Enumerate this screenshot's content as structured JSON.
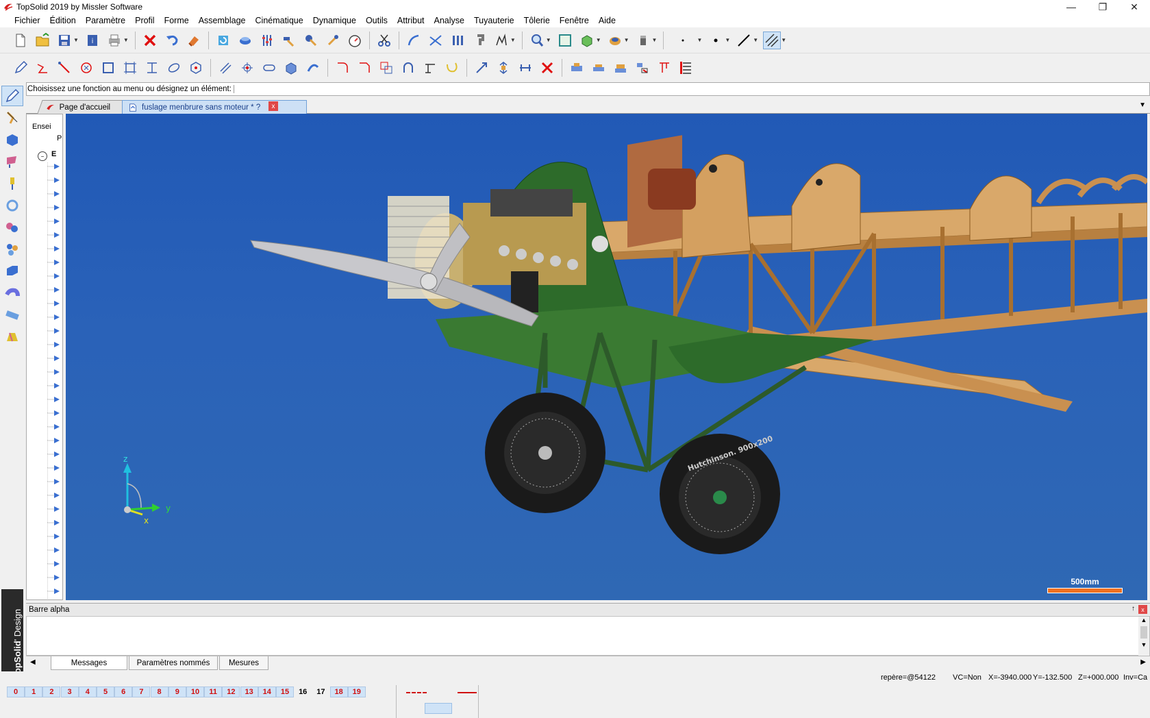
{
  "window": {
    "title": "TopSolid 2019 by Missler Software",
    "minimize": "—",
    "restore": "❐",
    "close": "✕"
  },
  "menu": [
    "Fichier",
    "Édition",
    "Paramètre",
    "Profil",
    "Forme",
    "Assemblage",
    "Cinématique",
    "Dynamique",
    "Outils",
    "Attribut",
    "Analyse",
    "Tuyauterie",
    "Tôlerie",
    "Fenêtre",
    "Aide"
  ],
  "prompt": {
    "text": "Choisissez une fonction au menu ou désignez un élément:"
  },
  "tabs": {
    "home": "Page d'accueil",
    "document": "fuslage menbrure sans moteur * ?",
    "close": "x",
    "dropdown": "▼"
  },
  "tree": {
    "header": "Ensei",
    "sub": "P",
    "root": "E",
    "scroll_left": "<"
  },
  "viewport": {
    "axis_z": "z",
    "axis_y": "y",
    "axis_x": "x",
    "scale_label": "500mm",
    "tire_text": "Hutchinson.  900x200"
  },
  "alpha": {
    "title": "Barre alpha",
    "pin": "↑",
    "close": "x",
    "scroll_up": "▲",
    "scroll_down": "▼"
  },
  "bottom_tabs": {
    "left_arrow": "◀",
    "right_arrow": "▶",
    "items": [
      "Messages",
      "Paramètres nommés",
      "Mesures"
    ]
  },
  "status": {
    "repere": "repère=@54122",
    "vc": "VC=Non",
    "x": "X=-3940.000",
    "y": "Y=-132.500",
    "z": "Z=+000.000",
    "inv": "Inv=Ca"
  },
  "layers": [
    "0",
    "1",
    "2",
    "3",
    "4",
    "5",
    "6",
    "7",
    "8",
    "9",
    "10",
    "11",
    "12",
    "13",
    "14",
    "15",
    "16",
    "17",
    "18",
    "19"
  ],
  "brand": {
    "bold": "TopSolid",
    "rest": "' Design"
  },
  "colors": {
    "viewport_bg": "#2159b6",
    "accent": "#d01010",
    "scale_bar": "#f07020",
    "frame_green": "#2d6b2a",
    "wood": "#d9a86a"
  }
}
